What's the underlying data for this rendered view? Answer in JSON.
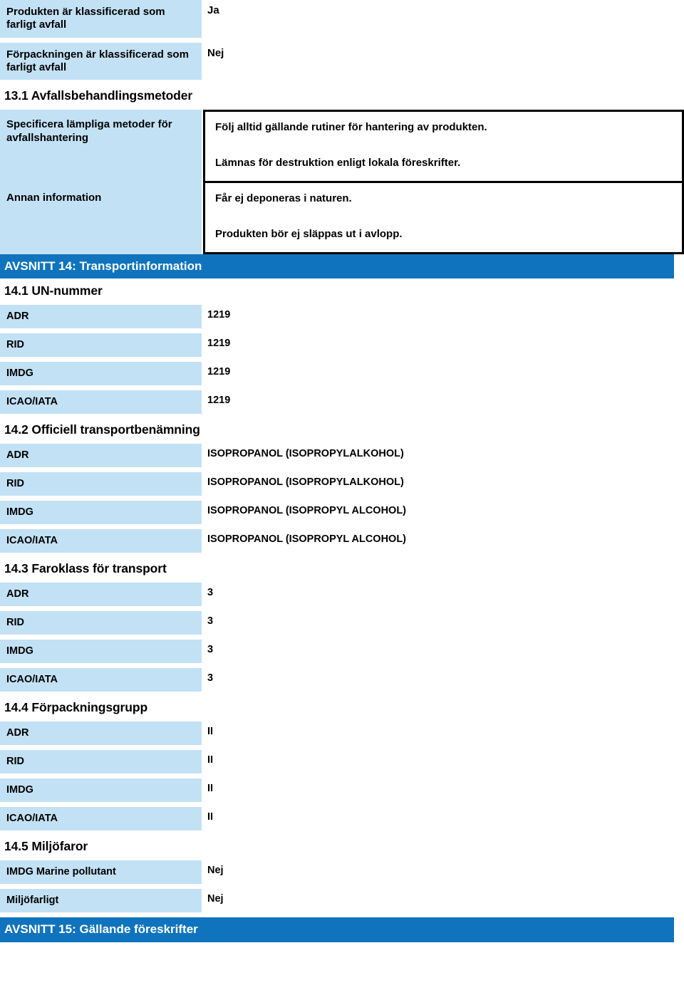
{
  "document": {
    "language": "sv",
    "accent_blue": "#0f74bd",
    "label_blue": "#c2e1f5"
  },
  "waste_classification_rows": [
    {
      "label": "Produkten är klassificerad som farligt avfall",
      "value": "Ja"
    },
    {
      "label": "Förpackningen är klassificerad som farligt avfall",
      "value": "Nej"
    }
  ],
  "section_13_1": {
    "heading": "13.1 Avfallsbehandlingsmetoder",
    "rows": [
      {
        "label": "Specificera lämpliga metoder för avfallshantering",
        "paragraphs": [
          "Följ alltid gällande rutiner för hantering av produkten.",
          "Lämnas för destruktion enligt lokala föreskrifter."
        ]
      },
      {
        "label": "Annan information",
        "paragraphs": [
          "Får ej deponeras i naturen.",
          "Produkten bör ej släppas ut i avlopp."
        ]
      }
    ]
  },
  "section_14": {
    "banner": "AVSNITT 14: Transportinformation",
    "subsections": [
      {
        "heading": "14.1 UN-nummer",
        "rows": [
          {
            "label": "ADR",
            "value": "1219"
          },
          {
            "label": "RID",
            "value": "1219"
          },
          {
            "label": "IMDG",
            "value": "1219"
          },
          {
            "label": "ICAO/IATA",
            "value": "1219"
          }
        ]
      },
      {
        "heading": "14.2 Officiell transportbenämning",
        "rows": [
          {
            "label": "ADR",
            "value": "ISOPROPANOL (ISOPROPYLALKOHOL)"
          },
          {
            "label": "RID",
            "value": "ISOPROPANOL (ISOPROPYLALKOHOL)"
          },
          {
            "label": "IMDG",
            "value": "ISOPROPANOL (ISOPROPYL ALCOHOL)"
          },
          {
            "label": "ICAO/IATA",
            "value": "ISOPROPANOL (ISOPROPYL ALCOHOL)"
          }
        ]
      },
      {
        "heading": "14.3 Faroklass för transport",
        "rows": [
          {
            "label": "ADR",
            "value": "3"
          },
          {
            "label": "RID",
            "value": "3"
          },
          {
            "label": "IMDG",
            "value": "3"
          },
          {
            "label": "ICAO/IATA",
            "value": "3"
          }
        ]
      },
      {
        "heading": "14.4 Förpackningsgrupp",
        "rows": [
          {
            "label": "ADR",
            "value": "II"
          },
          {
            "label": "RID",
            "value": "II"
          },
          {
            "label": "IMDG",
            "value": "II"
          },
          {
            "label": "ICAO/IATA",
            "value": "II"
          }
        ]
      },
      {
        "heading": "14.5 Miljöfaror",
        "rows": [
          {
            "label": "IMDG Marine pollutant",
            "value": "Nej"
          },
          {
            "label": "Miljöfarligt",
            "value": "Nej"
          }
        ]
      }
    ]
  },
  "section_15": {
    "banner": "AVSNITT 15: Gällande föreskrifter"
  }
}
